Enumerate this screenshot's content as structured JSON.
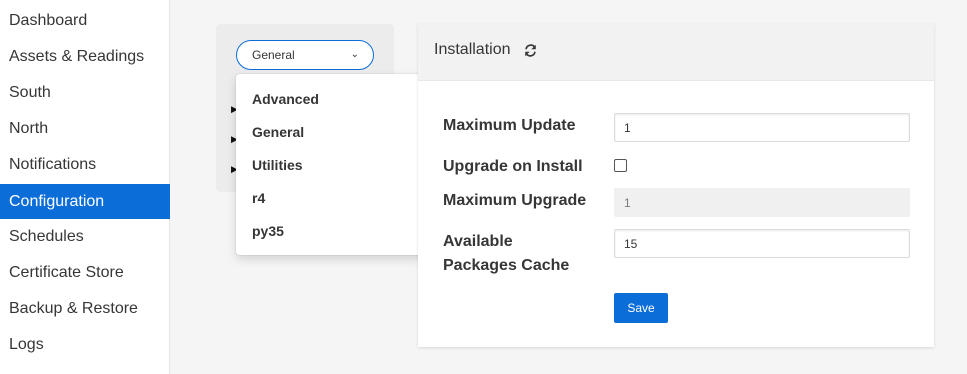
{
  "sidebar": {
    "items": [
      {
        "label": "Dashboard"
      },
      {
        "label": "Assets & Readings"
      },
      {
        "label": "South"
      },
      {
        "label": "North"
      },
      {
        "label": "Notifications"
      },
      {
        "label": "Configuration",
        "active": true
      },
      {
        "label": "Schedules"
      },
      {
        "label": "Certificate Store"
      },
      {
        "label": "Backup & Restore"
      },
      {
        "label": "Logs"
      }
    ]
  },
  "category_select": {
    "selected": "General",
    "options": [
      "Advanced",
      "General",
      "Utilities",
      "r4",
      "py35"
    ]
  },
  "panel": {
    "title": "Installation",
    "fields": {
      "max_update": {
        "label": "Maximum Update",
        "value": "1"
      },
      "upgrade_on_install": {
        "label": "Upgrade on Install",
        "checked": false
      },
      "max_upgrade": {
        "label": "Maximum Upgrade",
        "value": "1"
      },
      "packages_cache": {
        "label_line1": "Available",
        "label_line2": "Packages Cache",
        "value": "15"
      }
    },
    "save_label": "Save"
  },
  "colors": {
    "accent": "#0b6dd8",
    "background": "#f5f5f5"
  }
}
